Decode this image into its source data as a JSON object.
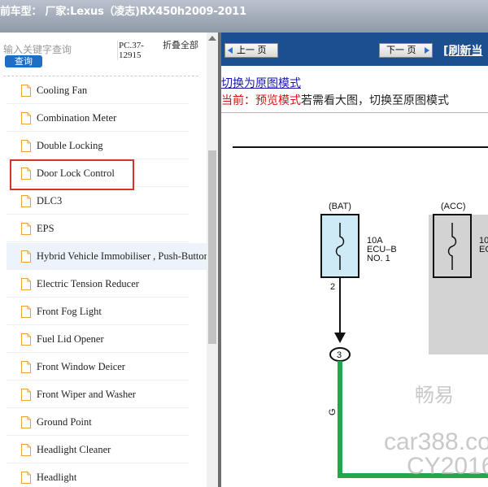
{
  "app": {
    "title": "前车型： 厂家:Lexus（凌志)RX450h2009-2011"
  },
  "search": {
    "placeholder": "输入关键字查询",
    "button_label": "查询",
    "pc_code": "PC.37-12915",
    "collapse_label": "折叠全部"
  },
  "tree": {
    "items": [
      {
        "label": "Cooling Fan"
      },
      {
        "label": "Combination Meter"
      },
      {
        "label": "Double Locking"
      },
      {
        "label": "Door Lock Control"
      },
      {
        "label": "DLC3"
      },
      {
        "label": "EPS"
      },
      {
        "label": "Hybrid Vehicle Immobiliser , Push-Button Start"
      },
      {
        "label": "Electric Tension Reducer"
      },
      {
        "label": "Front Fog Light"
      },
      {
        "label": "Fuel Lid Opener"
      },
      {
        "label": "Front Window Deicer"
      },
      {
        "label": "Front Wiper and Washer"
      },
      {
        "label": "Ground Point"
      },
      {
        "label": "Headlight Cleaner"
      },
      {
        "label": "Headlight"
      }
    ],
    "highlighted_item": "Door Lock Control"
  },
  "viewer": {
    "prev_label": "上一 页",
    "next_label": "下一 页",
    "refresh_label": "[刷新当",
    "switch_link": "切换为原图模式",
    "mode_prefix": "当前：预览模式",
    "mode_hint": "若需看大图，切换至原图模式"
  },
  "diagram": {
    "bat_label": "(BAT)",
    "acc_label": "(ACC)",
    "fuse_rating": "10A",
    "fuse_name": "ECU–B",
    "fuse_no": "NO. 1",
    "fuse2_partial": "10",
    "fuse2_partial2": "EC",
    "pin_number": "2",
    "connector_number": "3",
    "wire_color": "G",
    "watermark_cn": "畅易",
    "watermark_site": "car388.co",
    "watermark_code": "CY2016"
  },
  "colors": {
    "nav_bar": "#1c4f8d",
    "highlight": "#d9322c",
    "wire_green": "#22a84a",
    "fuse_fill": "#cfeaf7"
  }
}
